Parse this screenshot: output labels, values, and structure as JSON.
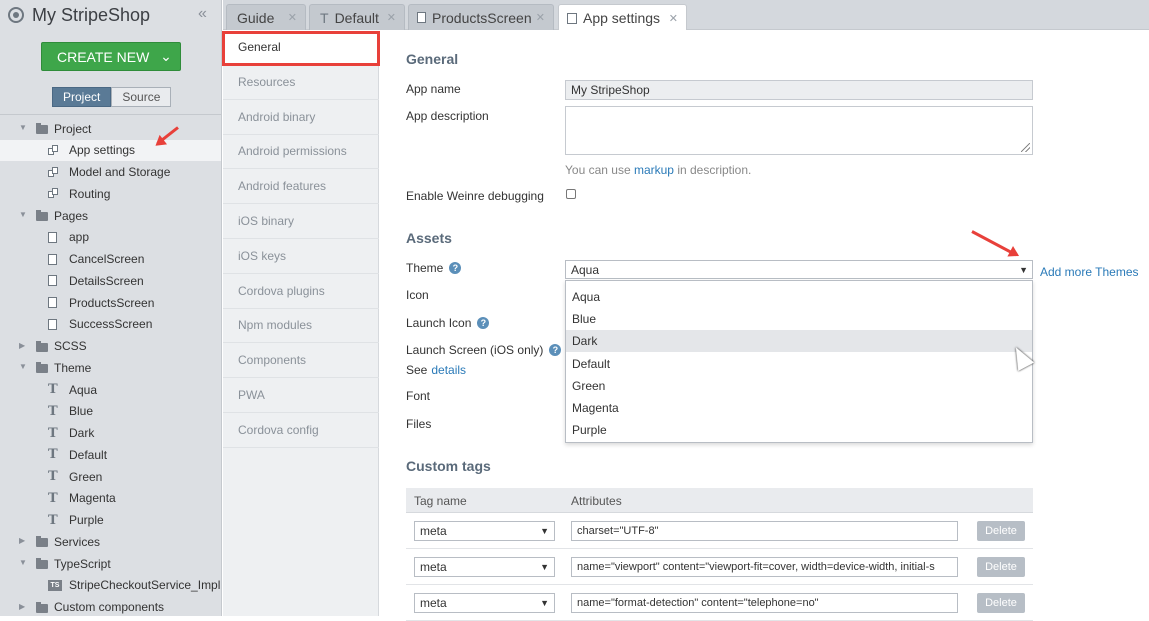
{
  "app": {
    "title": "My StripeShop",
    "collapse_glyph": "«"
  },
  "create": {
    "label": "CREATE NEW",
    "chevron": "⌄"
  },
  "seg": {
    "project": "Project",
    "source": "Source"
  },
  "tree": [
    {
      "label": "Project",
      "kind": "folder"
    },
    {
      "label": "App settings",
      "kind": "settings"
    },
    {
      "label": "Model and Storage",
      "kind": "settings"
    },
    {
      "label": "Routing",
      "kind": "settings"
    },
    {
      "label": "Pages",
      "kind": "folder"
    },
    {
      "label": "app",
      "kind": "page"
    },
    {
      "label": "CancelScreen",
      "kind": "page"
    },
    {
      "label": "DetailsScreen",
      "kind": "page"
    },
    {
      "label": "ProductsScreen",
      "kind": "page"
    },
    {
      "label": "SuccessScreen",
      "kind": "page"
    },
    {
      "label": "SCSS",
      "kind": "folder"
    },
    {
      "label": "Theme",
      "kind": "folder"
    },
    {
      "label": "Aqua",
      "kind": "theme"
    },
    {
      "label": "Blue",
      "kind": "theme"
    },
    {
      "label": "Dark",
      "kind": "theme"
    },
    {
      "label": "Default",
      "kind": "theme"
    },
    {
      "label": "Green",
      "kind": "theme"
    },
    {
      "label": "Magenta",
      "kind": "theme"
    },
    {
      "label": "Purple",
      "kind": "theme"
    },
    {
      "label": "Services",
      "kind": "folder"
    },
    {
      "label": "TypeScript",
      "kind": "folder"
    },
    {
      "label": "StripeCheckoutService_Impl",
      "kind": "ts",
      "badge": "TS"
    },
    {
      "label": "Custom components",
      "kind": "folder"
    }
  ],
  "tabs": [
    {
      "label": "Guide",
      "close": "✕"
    },
    {
      "label": "Default",
      "icon": "T",
      "close": "✕"
    },
    {
      "label": "ProductsScreen",
      "close": "✕"
    },
    {
      "label": "App settings",
      "close": "✕"
    }
  ],
  "nav": [
    "General",
    "Resources",
    "Android binary",
    "Android permissions",
    "Android features",
    "iOS binary",
    "iOS keys",
    "Cordova plugins",
    "Npm modules",
    "Components",
    "PWA",
    "Cordova config"
  ],
  "general": {
    "heading": "General",
    "app_name_label": "App name",
    "app_name_value": "My StripeShop",
    "app_desc_label": "App description",
    "markup_hint_pre": "You can use",
    "markup_link": "markup",
    "markup_hint_post": "in description.",
    "weinre_label": "Enable Weinre debugging"
  },
  "assets": {
    "heading": "Assets",
    "theme_label": "Theme",
    "theme_value": "Aqua",
    "add_themes": "Add more Themes",
    "icon_label": "Icon",
    "launch_icon_label": "Launch Icon",
    "launch_screen_label": "Launch Screen (iOS only)",
    "see": "See",
    "details": "details",
    "font_label": "Font",
    "files_label": "Files",
    "help_glyph": "?",
    "options": [
      "Aqua",
      "Blue",
      "Dark",
      "Default",
      "Green",
      "Magenta",
      "Purple"
    ],
    "highlighted": "Dark"
  },
  "custom_tags": {
    "heading": "Custom tags",
    "col_tag": "Tag name",
    "col_attr": "Attributes",
    "rows": [
      {
        "tag": "meta",
        "attr": "charset=\"UTF-8\"",
        "delete": "Delete"
      },
      {
        "tag": "meta",
        "attr": "name=\"viewport\" content=\"viewport-fit=cover, width=device-width, initial-s",
        "delete": "Delete"
      },
      {
        "tag": "meta",
        "attr": "name=\"format-detection\" content=\"telephone=no\"",
        "delete": "Delete"
      }
    ]
  },
  "colors": {
    "accent": "#3ea64a",
    "highlight_red": "#e8403a",
    "link": "#2a7ab8"
  }
}
